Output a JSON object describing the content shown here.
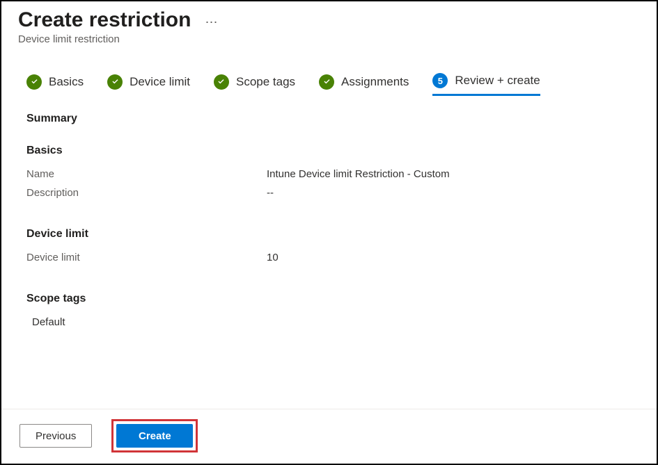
{
  "header": {
    "title": "Create restriction",
    "subtitle": "Device limit restriction",
    "more_icon": "more-horizontal-icon"
  },
  "steps": [
    {
      "label": "Basics",
      "state": "done"
    },
    {
      "label": "Device limit",
      "state": "done"
    },
    {
      "label": "Scope tags",
      "state": "done"
    },
    {
      "label": "Assignments",
      "state": "done"
    },
    {
      "label": "Review + create",
      "state": "current",
      "number": "5"
    }
  ],
  "summary": {
    "heading": "Summary",
    "sections": {
      "basics": {
        "heading": "Basics",
        "rows": [
          {
            "label": "Name",
            "value": "Intune Device limit Restriction - Custom"
          },
          {
            "label": "Description",
            "value": "--"
          }
        ]
      },
      "device_limit": {
        "heading": "Device limit",
        "rows": [
          {
            "label": "Device limit",
            "value": "10"
          }
        ]
      },
      "scope_tags": {
        "heading": "Scope tags",
        "items": [
          "Default"
        ]
      }
    }
  },
  "footer": {
    "previous_label": "Previous",
    "create_label": "Create"
  },
  "colors": {
    "done_green": "#498205",
    "primary_blue": "#0078d4",
    "highlight_red": "#d13438"
  }
}
